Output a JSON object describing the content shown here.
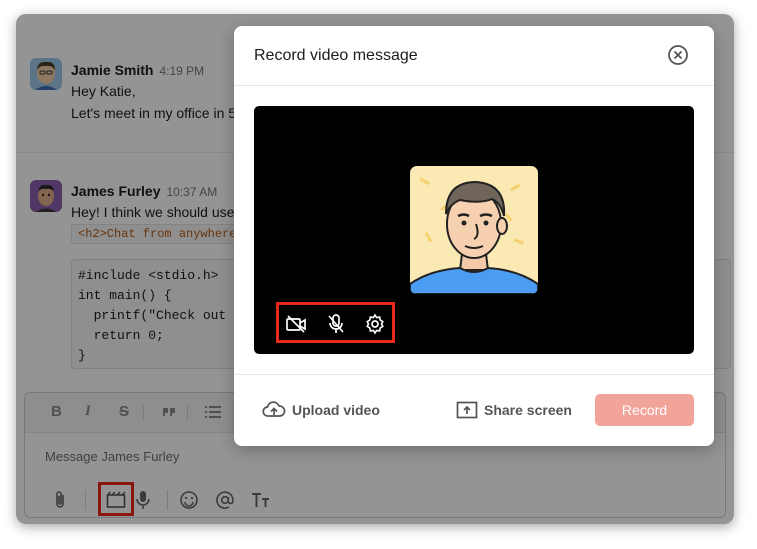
{
  "messages": [
    {
      "author": "Jamie Smith",
      "time": "4:19 PM",
      "lines": [
        "Hey Katie,",
        "Let's meet in my office in 5"
      ]
    },
    {
      "author": "James Furley",
      "time": "10:37 AM",
      "lines": [
        "Hey! I think we should use"
      ],
      "inline_code": "<h2>Chat from anywhere",
      "code_block": [
        "#include <stdio.h>",
        "int main() {",
        "  printf(\"Check out",
        "  return 0;",
        "}"
      ]
    }
  ],
  "composer": {
    "placeholder": "Message James Furley",
    "format_buttons": [
      "B",
      "I",
      "S",
      "quote",
      "list"
    ],
    "tools": [
      "attach-icon",
      "video-clip-icon",
      "microphone-icon",
      "emoji-icon",
      "mention-icon",
      "text-format-icon"
    ]
  },
  "modal": {
    "title": "Record video message",
    "upload_label": "Upload video",
    "share_label": "Share screen",
    "record_label": "Record",
    "video_controls": [
      "camera-off-icon",
      "mic-off-icon",
      "settings-icon"
    ]
  },
  "colors": {
    "record_button": "#f2a39a",
    "highlight": "#e8281a",
    "video_background": "#000000"
  }
}
